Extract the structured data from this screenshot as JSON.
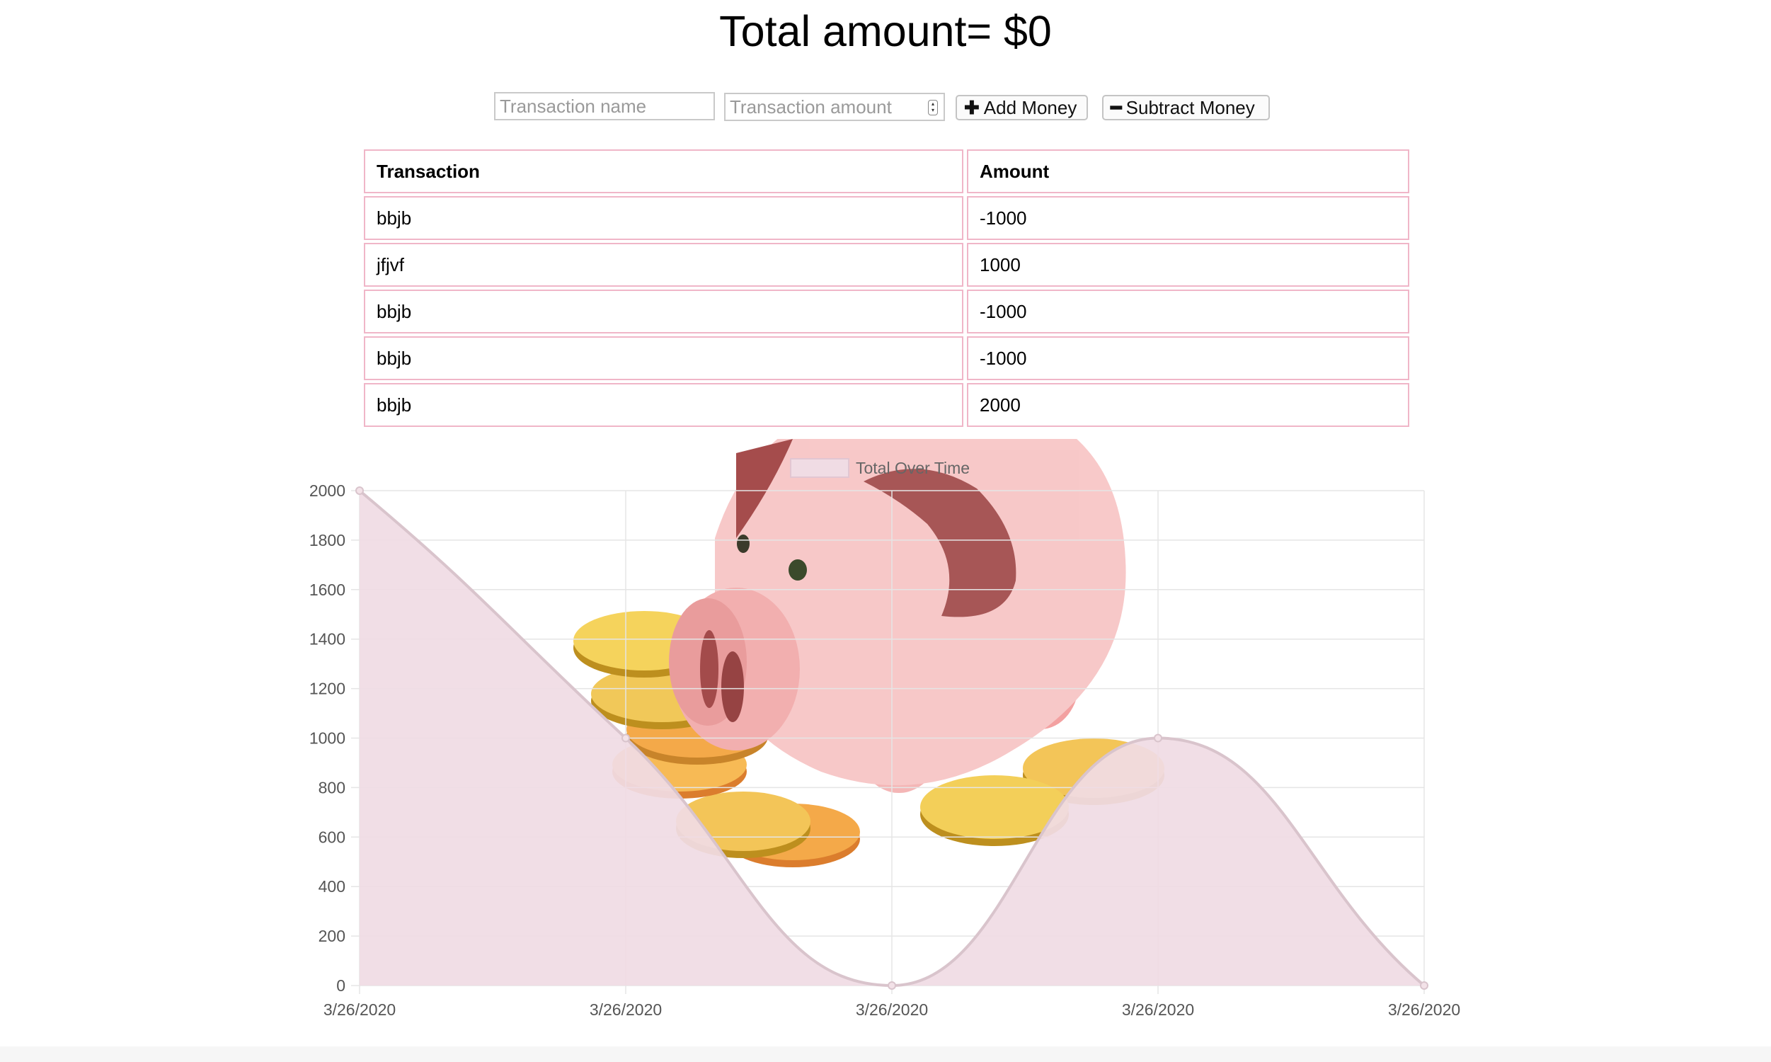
{
  "header": {
    "total_label": "Total amount= $0"
  },
  "form": {
    "name_placeholder": "Transaction name",
    "amount_placeholder": "Transaction amount",
    "add_label": "Add Money",
    "subtract_label": "Subtract Money",
    "add_icon": "plus-icon",
    "subtract_icon": "minus-icon"
  },
  "table": {
    "headers": [
      "Transaction",
      "Amount"
    ],
    "rows": [
      [
        "bbjb",
        "-1000"
      ],
      [
        "jfjvf",
        "1000"
      ],
      [
        "bbjb",
        "-1000"
      ],
      [
        "bbjb",
        "-1000"
      ],
      [
        "bbjb",
        "2000"
      ]
    ],
    "border_color": "#f0b6c8"
  },
  "background_image": "piggy-bank-with-coins-illustration",
  "chart_data": {
    "type": "area",
    "categories": [
      "3/26/2020",
      "3/26/2020",
      "3/26/2020",
      "3/26/2020",
      "3/26/2020"
    ],
    "series": [
      {
        "name": "Total Over Time",
        "values": [
          2000,
          1000,
          0,
          1000,
          0
        ]
      }
    ],
    "y_ticks": [
      "0",
      "200",
      "400",
      "600",
      "800",
      "1000",
      "1200",
      "1400",
      "1600",
      "1800",
      "2000"
    ],
    "ylim": [
      0,
      2000
    ],
    "grid": true,
    "legend_position": "top",
    "fill_color": "#f0dce4",
    "line_color": "#d9c4cc"
  }
}
